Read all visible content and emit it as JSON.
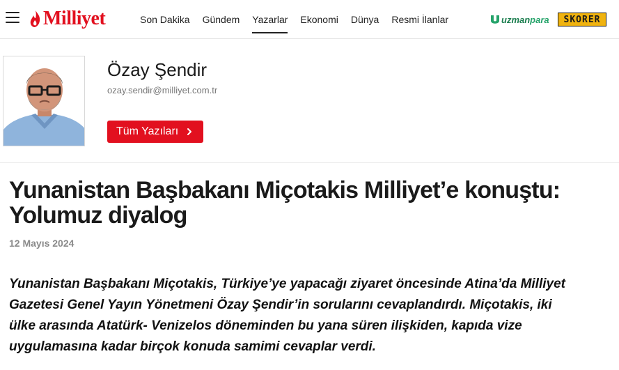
{
  "header": {
    "logo_text": "Milliyet",
    "nav": [
      {
        "label": "Son Dakika"
      },
      {
        "label": "Gündem"
      },
      {
        "label": "Yazarlar",
        "active": true
      },
      {
        "label": "Ekonomi"
      },
      {
        "label": "Dünya"
      },
      {
        "label": "Resmi İlanlar"
      }
    ],
    "partners": {
      "uzmanpara_a": "uzman",
      "uzmanpara_b": "para",
      "skorer": "SKORER"
    },
    "colors": {
      "brand_red": "#e2101f",
      "uzmanpara_green": "#25a36a",
      "skorer_yellow": "#f0b30f"
    }
  },
  "author": {
    "name": "Özay Şendir",
    "email": "ozay.sendir@milliyet.com.tr",
    "all_posts_label": "Tüm Yazıları"
  },
  "article": {
    "title": "Yunanistan Başbakanı Miçotakis Milliyet’e konuştu: Yolumuz diyalog",
    "date": "12 Mayıs 2024",
    "lead": "Yunanistan Başbakanı Miçotakis, Türkiye’ye yapacağı ziyaret öncesinde Atina’da Milliyet Gazetesi Genel Yayın Yönetmeni Özay Şendir’in sorularını cevaplandırdı. Miçotakis, iki ülke arasında Atatürk- Venizelos döneminden bu yana süren ilişkiden, kapıda vize uygulamasına kadar birçok konuda samimi cevaplar verdi."
  }
}
